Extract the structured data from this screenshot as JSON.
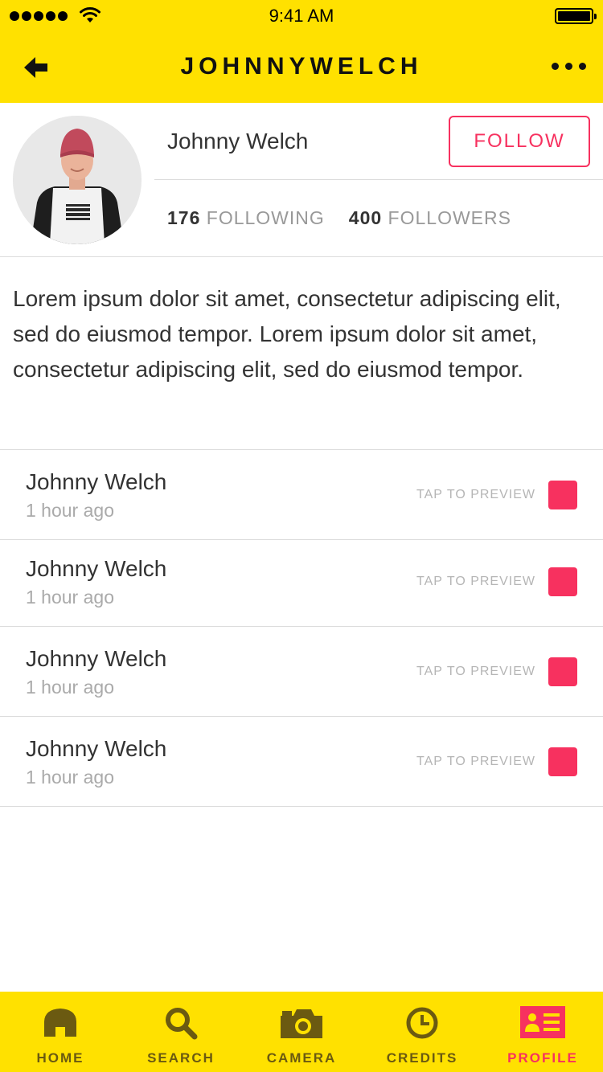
{
  "status_bar": {
    "time": "9:41 AM"
  },
  "header": {
    "title": "JOHNNYWELCH",
    "back_icon": "arrow-left-icon",
    "more_icon": "more-dots-icon"
  },
  "profile": {
    "name": "Johnny Welch",
    "follow_label": "FOLLOW",
    "following_count": "176",
    "following_label": "FOLLOWING",
    "followers_count": "400",
    "followers_label": "FOLLOWERS"
  },
  "bio": "Lorem ipsum dolor sit amet, consectetur adipiscing elit, sed do eiusmod tempor. Lorem ipsum dolor sit amet, consectetur adipiscing elit, sed do eiusmod tempor.",
  "feed": [
    {
      "name": "Johnny Welch",
      "time": "1 hour ago",
      "action": "TAP TO PREVIEW"
    },
    {
      "name": "Johnny Welch",
      "time": "1 hour ago",
      "action": "TAP TO PREVIEW"
    },
    {
      "name": "Johnny Welch",
      "time": "1 hour ago",
      "action": "TAP TO PREVIEW"
    },
    {
      "name": "Johnny Welch",
      "time": "1 hour ago",
      "action": "TAP TO PREVIEW"
    }
  ],
  "tabs": [
    {
      "label": "HOME",
      "icon": "home-icon"
    },
    {
      "label": "SEARCH",
      "icon": "search-icon"
    },
    {
      "label": "CAMERA",
      "icon": "camera-icon"
    },
    {
      "label": "CREDITS",
      "icon": "clock-icon"
    },
    {
      "label": "PROFILE",
      "icon": "profile-card-icon",
      "active": true
    }
  ],
  "colors": {
    "brand_yellow": "#FFE100",
    "accent_pink": "#F7315F",
    "tab_icon": "#6b5a11"
  }
}
